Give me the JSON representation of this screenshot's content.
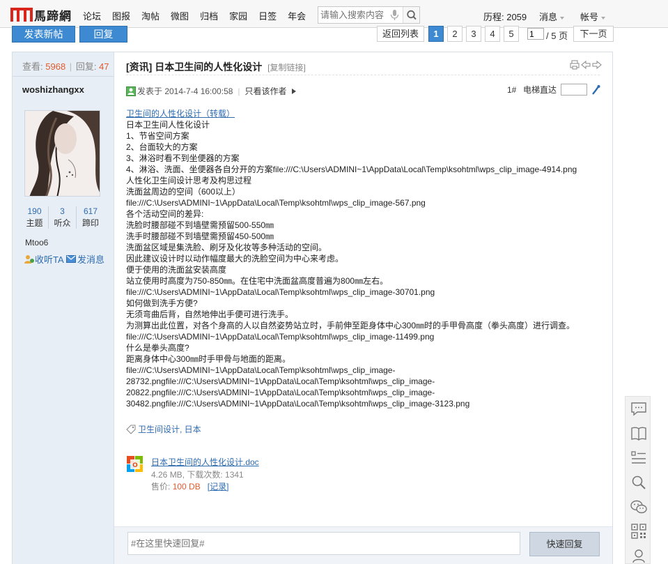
{
  "header": {
    "logo_text": "馬蹄網",
    "nav": [
      "论坛",
      "图报",
      "淘帖",
      "微图",
      "归档",
      "家园",
      "日签",
      "年会"
    ],
    "search_placeholder": "请输入搜索内容",
    "rank_label": "历程: 2059",
    "menu_messages": "消息",
    "menu_account": "帐号"
  },
  "actions": {
    "new_post": "发表新帖",
    "reply": "回复",
    "back_to_list": "返回列表",
    "pages": [
      "1",
      "2",
      "3",
      "4",
      "5"
    ],
    "current_page_value": "1",
    "total_pages": "/ 5 页",
    "next_page": "下一页"
  },
  "sidebar": {
    "views_label": "查看:",
    "views": "5968",
    "replies_label": "回复:",
    "replies": "47",
    "username": "woshizhangxx",
    "stats": [
      {
        "value": "190",
        "label": "主题"
      },
      {
        "value": "3",
        "label": "听众"
      },
      {
        "value": "617",
        "label": "蹄印"
      }
    ],
    "group": "Mtoo6",
    "follow": "收听TA",
    "message": "发消息"
  },
  "post": {
    "category": "[资讯]",
    "title": "日本卫生间的人性化设计",
    "copy_link": "[复制链接]",
    "posted_at": "发表于 2014-7-4 16:00:58",
    "only_author": "只看该作者",
    "floor": "1#",
    "jump_label": "电梯直达",
    "link_line": "卫生间的人性化设计（转载）",
    "lines": [
      "日本卫生间人性化设计",
      "1、节省空间方案",
      "2、台面较大的方案",
      "3、淋浴时看不到坐便器的方案",
      "4、淋浴、洗面、坐便器各自分开的方案file:///C:\\Users\\ADMINI~1\\AppData\\Local\\Temp\\ksohtml\\wps_clip_image-4914.png",
      "人性化卫生间设计思考及构思过程",
      "洗面盆周边的空间（600以上）",
      "file:///C:\\Users\\ADMINI~1\\AppData\\Local\\Temp\\ksohtml\\wps_clip_image-567.png",
      "各个活动空间的差异:",
      "洗脸时腰部碰不到墙壁需预留500-550㎜",
      "洗手时腰部碰不到墙壁需预留450-500㎜",
      "洗面盆区域是集洗脸、刷牙及化妆等多种活动的空间。",
      "因此建议设计时以动作幅度最大的洗脸空间为中心来考虑。",
      "便于使用的洗面盆安装高度",
      "站立使用时高度为750-850㎜。在住宅中洗面盆高度普遍为800㎜左右。",
      "file:///C:\\Users\\ADMINI~1\\AppData\\Local\\Temp\\ksohtml\\wps_clip_image-30701.png",
      "如何做到洗手方便?",
      "无须弯曲后背，自然地伸出手便可进行洗手。",
      "为测算出此位置，对各个身高的人以自然姿势站立时，手前伸至距身体中心300㎜时的手甲骨高度（拳头高度）进行调查。",
      "file:///C:\\Users\\ADMINI~1\\AppData\\Local\\Temp\\ksohtml\\wps_clip_image-11499.png",
      "什么是拳头高度?",
      "距离身体中心300㎜时手甲骨与地面的距离。",
      "file:///C:\\Users\\ADMINI~1\\AppData\\Local\\Temp\\ksohtml\\wps_clip_image-",
      "28732.pngfile:///C:\\Users\\ADMINI~1\\AppData\\Local\\Temp\\ksohtml\\wps_clip_image-",
      "20822.pngfile:///C:\\Users\\ADMINI~1\\AppData\\Local\\Temp\\ksohtml\\wps_clip_image-",
      "30482.pngfile:///C:\\Users\\ADMINI~1\\AppData\\Local\\Temp\\ksohtml\\wps_clip_image-3123.png"
    ],
    "tags": "卫生间设计, 日本",
    "attachment": {
      "name": "日本卫生间的人性化设计.doc",
      "meta": "4.26 MB, 下载次数: 1341",
      "price_label": "售价:",
      "price": "100 DB",
      "record": "[记录]"
    }
  },
  "quick_reply": {
    "placeholder": "#在这里快速回复#",
    "button": "快速回复"
  },
  "float_toolbar": [
    "comment-icon",
    "book-icon",
    "list-icon",
    "search-icon",
    "wechat-icon",
    "qrcode-icon",
    "user-icon"
  ],
  "colors": {
    "accent_blue": "#3d8ad2",
    "link_blue": "#2e6cb0",
    "logo_red": "#d9261c",
    "count_orange": "#e15a2f"
  }
}
